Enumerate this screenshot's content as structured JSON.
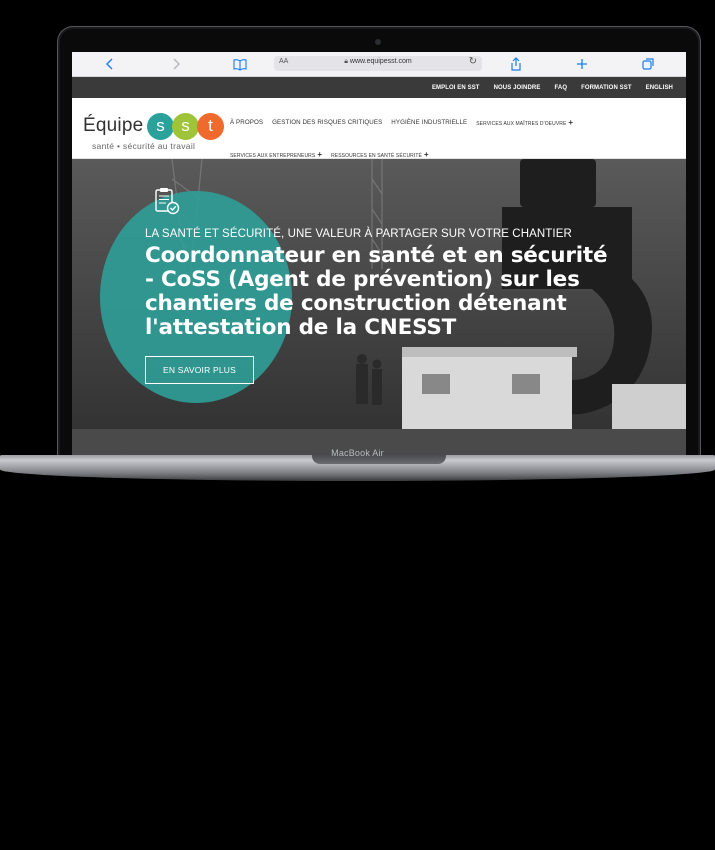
{
  "device": {
    "model_label": "MacBook Air"
  },
  "browser": {
    "icons": [
      "chevron-left-icon",
      "chevron-right-icon",
      "book-icon",
      "share-icon",
      "plus-icon",
      "tabs-icon"
    ],
    "text_size_label": "AA",
    "url": "www.equipesst.com"
  },
  "topnav": {
    "links": [
      "EMPLOI EN SST",
      "NOUS JOINDRE",
      "FAQ",
      "FORMATION SST",
      "ENGLISH"
    ]
  },
  "logo": {
    "word": "Équipe",
    "letters": [
      "s",
      "s",
      "t"
    ],
    "colors": [
      "#2aa19b",
      "#9fc43a",
      "#ef6b2d"
    ],
    "tagline": "santé • sécurité au travail"
  },
  "mainnav": {
    "row1": [
      "À PROPOS",
      "GESTION DES RISQUES CRITIQUES",
      "HYGIÈNE INDUSTRIELLE",
      "SERVICES AUX MAÎTRES D'OEUVRE"
    ],
    "row2": [
      "SERVICES AUX ENTREPRENEURS",
      "RESSOURCES EN SANTÉ SÉCURITÉ"
    ],
    "expand_symbol": "+"
  },
  "hero": {
    "kicker": "LA SANTÉ ET SÉCURITÉ, UNE VALEUR À PARTAGER SUR VOTRE CHANTIER",
    "headline": "Coordonnateur en santé et en sécurité - CoSS (Agent de prévention) sur les chantiers de construction détenant l'attestation de la CNESST",
    "cta": "EN SAVOIR PLUS",
    "accent_color": "#2f9f98"
  }
}
